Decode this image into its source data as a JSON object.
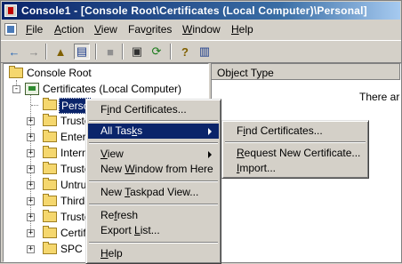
{
  "window": {
    "title": "Console1 - [Console Root\\Certificates (Local Computer)\\Personal]"
  },
  "menubar": [
    {
      "pre": "",
      "u": "F",
      "post": "ile"
    },
    {
      "pre": "",
      "u": "A",
      "post": "ction"
    },
    {
      "pre": "",
      "u": "V",
      "post": "iew"
    },
    {
      "pre": "Fav",
      "u": "o",
      "post": "rites"
    },
    {
      "pre": "",
      "u": "W",
      "post": "indow"
    },
    {
      "pre": "",
      "u": "H",
      "post": "elp"
    }
  ],
  "toolbar": {
    "back_icon": "←",
    "forward_icon": "→",
    "up_icon": "▲",
    "show_tree_icon": "▤",
    "delete_icon": "■",
    "properties_icon": "▣",
    "refresh_icon": "⟳",
    "export_icon": "▦",
    "help_icon": "?",
    "taskpad_icon": "▥"
  },
  "tree": {
    "root": "Console Root",
    "certificates": "Certificates (Local Computer)",
    "selected": "Perso",
    "children": [
      "Truste",
      "Enterp",
      "Interm",
      "Truste",
      "Untru",
      "Third-",
      "Truste",
      "Certif",
      "SPC"
    ]
  },
  "details": {
    "column_header": "Object Type",
    "empty_message": "There are"
  },
  "context_menu": {
    "find_certificates": {
      "pre": "F",
      "u": "i",
      "post": "nd Certificates..."
    },
    "all_tasks": {
      "pre": "All Tas",
      "u": "k",
      "post": "s"
    },
    "view": {
      "pre": "",
      "u": "V",
      "post": "iew"
    },
    "new_window": {
      "pre": "New ",
      "u": "W",
      "post": "indow from Here"
    },
    "new_taskpad": {
      "pre": "New ",
      "u": "T",
      "post": "askpad View..."
    },
    "refresh": {
      "pre": "Re",
      "u": "f",
      "post": "resh"
    },
    "export_list": {
      "pre": "Export ",
      "u": "L",
      "post": "ist..."
    },
    "help": {
      "pre": "",
      "u": "H",
      "post": "elp"
    }
  },
  "submenu": {
    "find_certificates": {
      "pre": "F",
      "u": "i",
      "post": "nd Certificates..."
    },
    "request_new": {
      "pre": "",
      "u": "R",
      "post": "equest New Certificate..."
    },
    "import": {
      "pre": "",
      "u": "I",
      "post": "mport..."
    }
  }
}
